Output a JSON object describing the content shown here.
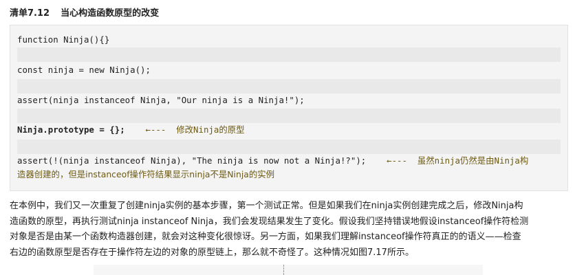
{
  "listing": {
    "number": "清单7.12",
    "title": "当心构造函数原型的改变"
  },
  "code": {
    "line1": "function Ninja(){}",
    "line2": "const ninja = new Ninja();",
    "line3": "assert(ninja instanceof Ninja, \"Our ninja is a Ninja!\");",
    "line4_code": "Ninja.prototype = {};",
    "line4_arrow": "←---",
    "line4_note": "修改Ninja的原型",
    "line5_code": "assert(!(ninja instanceof Ninja), \"The ninja is now not a Ninja!?\");",
    "line5_arrow": "←---",
    "line5_note_a": "虽然ninja仍然是由Ninja构",
    "line5_note_b": "造器创建的，但是instanceof操作符结果显示ninja不是Ninja的实例"
  },
  "paragraph": [
    "在本例中，我们又一次重复了创建ninja实例的基本步骤，第一个测试正常。但是如果我们在ninja实例创建完成之后，修改Ninja构",
    "造函数的原型，再执行测试ninja instanceof Ninja，我们会发现结果发生了变化。假设我们坚持错误地假设instanceof操作符检测",
    "对象是否是由某一个函数构造器创建，就会对这种变化很惊讶。另一方面，如果我们理解instanceof操作符真正的的语义——检查",
    "右边的函数原型是否存在于操作符左边的对象的原型链上，那么就不奇怪了。这种情况如图7.17所示。"
  ]
}
